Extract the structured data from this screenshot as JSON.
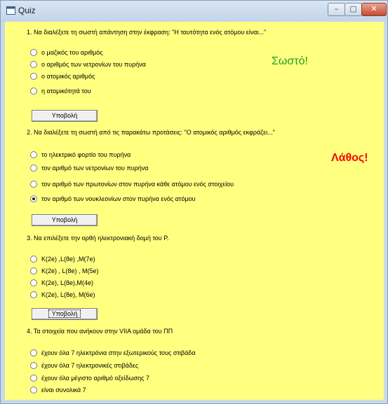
{
  "window": {
    "title": "Quiz"
  },
  "controls": {
    "min": "–",
    "max": "▢",
    "close": "✕"
  },
  "colors": {
    "background": "#ffff80",
    "correct": "#1f9f1f",
    "wrong": "#ff0000"
  },
  "questions": [
    {
      "text": "1. Να διαλέξετε τη σωστή απάντηση στην έκφραση: \"Η ταυτότητα ενός ατόμου είναι...\"",
      "options": [
        "ο μαζικός του αριθμός",
        "ο αριθμός των νετρονίων του πυρήνα",
        "ο ατομικός αριθμός",
        "η ατομικότητά του"
      ],
      "submit": "Υποβολή",
      "feedback": "Σωστό!"
    },
    {
      "text": "2. Να διαλέξετε τη σωστή από τις παρακάτω προτάσεις: \"Ο ατομικός αριθμός εκφράζει...\"",
      "options": [
        "το ηλεκτρικό φορτίο του πυρήνα",
        "τον αριθμό των νετρονίων του πυρήνα",
        "τον αριθμό των πρωτονίων στον πυρήνα κάθε ατόμου ενός στοιχείου",
        "τον αριθμό των νουκλεονίων στον πυρήνα ενός ατόμου"
      ],
      "selected": 3,
      "submit": "Υποβολή",
      "feedback": "Λάθος!"
    },
    {
      "text": "3. Να επιλέξετε την ορθή ηλεκτρονιακή δομή του P.",
      "options": [
        "K(2e) ,L(8e) ,M(7e)",
        "K(2e) , L(8e) , M(5e)",
        "K(2e), L(8e),M(4e)",
        "K(2e), L(8e), M(6e)"
      ],
      "submit": "Υποβολή"
    },
    {
      "text": "4. Τα στοιχεία που ανήκουν στην VIIA ομάδα του ΠΠ",
      "options": [
        "έχουν όλα 7 ηλεκτρόνια στην εξωτερικούς τους στιβάδα",
        "έχουν όλα 7 ηλεκτρονικές στιβάδες",
        "έχουν όλα μέγιστο αριθμό οξείδωσης  7",
        "είναι συνολικά 7"
      ]
    }
  ]
}
